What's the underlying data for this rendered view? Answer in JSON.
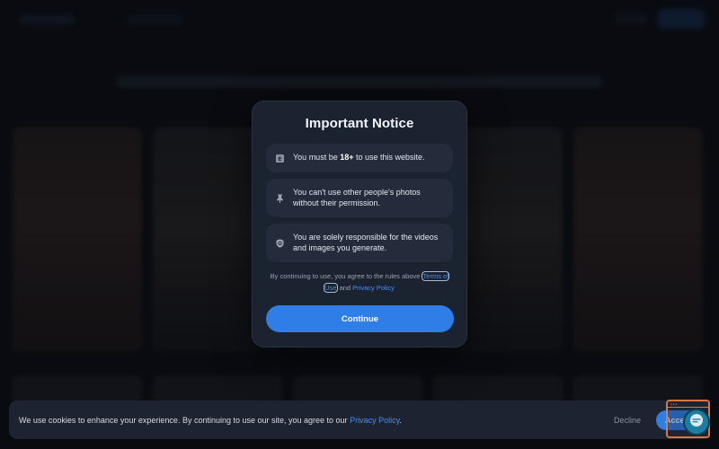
{
  "modal": {
    "title": "Important Notice",
    "items": [
      {
        "icon": "adult-rating-icon",
        "pre": "You must be ",
        "bold": "18+",
        "post": " to use this website."
      },
      {
        "icon": "pin-icon",
        "text": "You can't use other people's photos without their permission."
      },
      {
        "icon": "shield-icon",
        "text": "You are solely responsible for the videos and images you generate."
      }
    ],
    "agreement": {
      "prefix": "By continuing to use, you agree to the rules above ",
      "terms_label": "Terms of Use",
      "middle": " and ",
      "privacy_label": "Privacy Policy"
    },
    "continue_label": "Continue"
  },
  "cookie_banner": {
    "text": "We use cookies to enhance your experience. By continuing to use our site, you agree to our ",
    "privacy_label": "Privacy Policy",
    "suffix": ".",
    "decline_label": "Decline",
    "accept_label": "Accept"
  },
  "colors": {
    "accent": "#2f7de6",
    "link": "#4d8fe8",
    "modal_bg": "#1b2230",
    "item_bg": "#242c3b",
    "widget_border": "#d9773f"
  }
}
